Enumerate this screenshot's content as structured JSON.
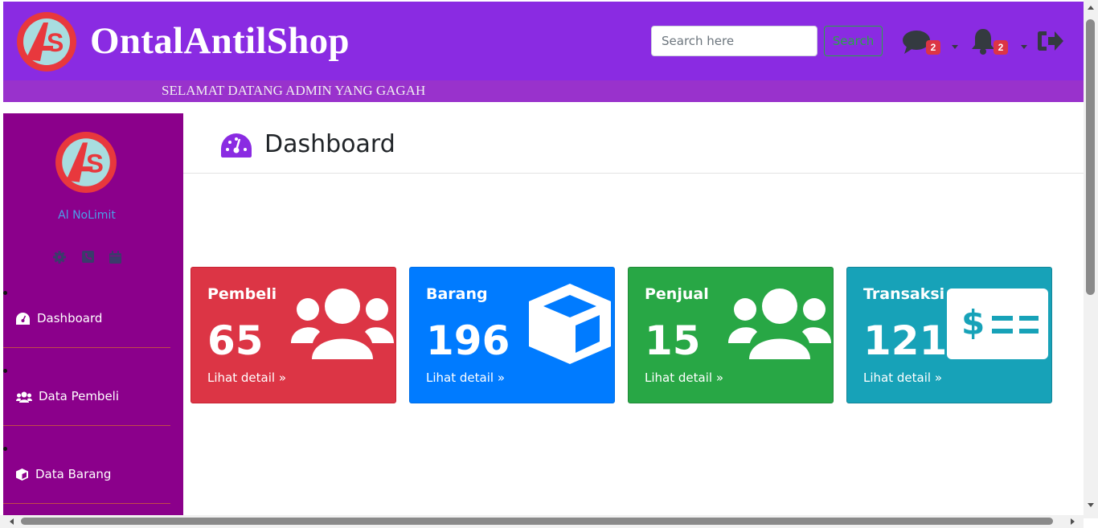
{
  "header": {
    "brand": "OntalAntilShop",
    "logo_icon": "as-logo-icon",
    "search": {
      "placeholder": "Search here",
      "button_label": "Search"
    },
    "messages": {
      "icon": "comment-icon",
      "count": "2"
    },
    "notifications": {
      "icon": "bell-icon",
      "count": "2"
    },
    "logout_icon": "sign-out-icon",
    "welcome_text": "SELAMAT DATANG ADMIN YANG GAGAH",
    "colors": {
      "bar": "#8a2be2",
      "welcome_bar": "#9932cc"
    }
  },
  "sidebar": {
    "username": "Al NoLimit",
    "quick_icons": [
      "gear-icon",
      "phone-square-icon",
      "calendar-icon"
    ],
    "items": [
      {
        "label": "Dashboard",
        "icon": "tachometer-icon"
      },
      {
        "label": "Data Pembeli",
        "icon": "users-icon"
      },
      {
        "label": "Data Barang",
        "icon": "cube-icon"
      }
    ],
    "colors": {
      "background": "#8b008b",
      "username": "#4b9fe8"
    }
  },
  "main": {
    "title": "Dashboard",
    "title_icon": "tachometer-icon",
    "cards": [
      {
        "title": "Pembeli",
        "value": "65",
        "link": "Lihat detail",
        "icon": "users-icon",
        "color": "#dc3545"
      },
      {
        "title": "Barang",
        "value": "196",
        "link": "Lihat detail",
        "icon": "cube-icon",
        "color": "#007bff"
      },
      {
        "title": "Penjual",
        "value": "15",
        "link": "Lihat detail",
        "icon": "users-icon",
        "color": "#28a745"
      },
      {
        "title": "Transaksi",
        "value": "121",
        "link": "Lihat detail",
        "icon": "money-check-icon",
        "color": "#17a2b8"
      }
    ]
  }
}
